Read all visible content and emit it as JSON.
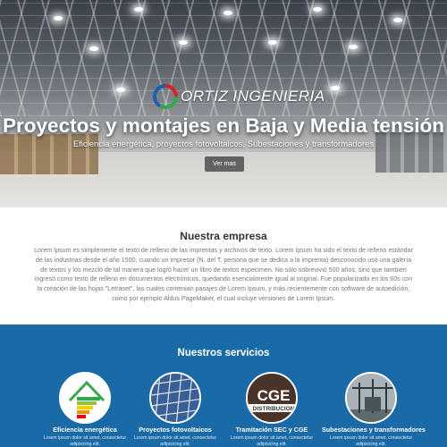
{
  "hero": {
    "logo_text": "ORTIZ INGENIERIA",
    "title": "Proyectos y montajes en Baja y Media tensión",
    "subtitle": "Eficiencia energética, proyectos fotovoltaicos, Subestaciones y transformadores",
    "button_label": "Ver mas"
  },
  "empresa": {
    "title": "Nuestra empresa",
    "text": "Lorem Ipsum es simplemente el texto de relleno de las imprentas y archivos de texto. Lorem Ipsum ha sido el texto de relleno estándar de las industrias desde el año 1500, cuando un impresor (N. del T. persona que se dedica a la imprenta) desconocido usó una galería de textos y los mezcló de tal manera que logró hacer un libro de textos especimen. No sólo sobrevivió 500 años, sino que tambien ingresó como texto de relleno en documentos electrónicos, quedando esencialmente igual al original. Fue popularizado en los 60s con la creación de las hojas \"Letraset\", las cuales contenian pasajes de Lorem Ipsum, y más recientemente con software de autoedición, como por ejemplo Aldus PageMaker, el cual incluye versiones de Lorem Ipsum."
  },
  "servicios": {
    "title": "Nuestros servicios",
    "items": [
      {
        "name": "Eficiencia energética",
        "desc": "Lorem ipsum dolor sit amet, consectetur adipisicing elit."
      },
      {
        "name": "Proyectos fotovoltaicos",
        "desc": "Lorem ipsum dolor sit amet, consectetur adipisicing elit."
      },
      {
        "name": "Tramitación SEC y CGE",
        "desc": "Lorem ipsum dolor sit amet, consectetur adipisicing elit.",
        "image_text": "CGE",
        "image_subtext": "DISTRIBUCION"
      },
      {
        "name": "Subestaciones y transformadores",
        "desc": "Lorem ipsum dolor sit amet, consectetur adipisicing elit."
      }
    ]
  },
  "colors": {
    "servicios_bg": "#1a6aa8",
    "hero_title": "#ffffff",
    "logo_red": "#d8232a",
    "logo_green": "#2ea84a",
    "logo_blue": "#1f5fb0"
  }
}
